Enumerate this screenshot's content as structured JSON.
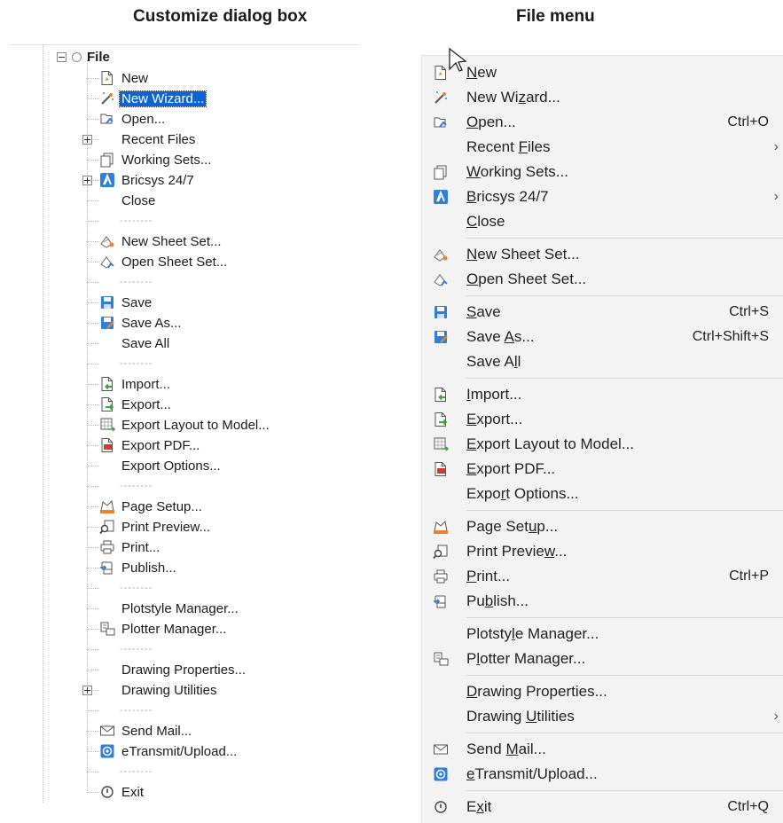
{
  "headings": {
    "left": "Customize dialog box",
    "right": "File menu"
  },
  "tree": {
    "root_label": "File",
    "nodes": [
      {
        "label": "New",
        "icon": "new-document-icon",
        "selected": false,
        "expandable": false
      },
      {
        "label": "New Wizard...",
        "icon": "magic-wand-icon",
        "selected": true,
        "expandable": false
      },
      {
        "label": "Open...",
        "icon": "open-file-icon",
        "selected": false,
        "expandable": false
      },
      {
        "label": "Recent Files",
        "icon": "",
        "selected": false,
        "expandable": true
      },
      {
        "label": "Working Sets...",
        "icon": "working-sets-icon",
        "selected": false,
        "expandable": false
      },
      {
        "label": "Bricsys 24/7",
        "icon": "bricsys-icon",
        "selected": false,
        "expandable": true
      },
      {
        "label": "Close",
        "icon": "",
        "selected": false,
        "expandable": false
      },
      {
        "separator": "--------"
      },
      {
        "label": "New Sheet Set...",
        "icon": "new-sheet-set-icon",
        "selected": false,
        "expandable": false
      },
      {
        "label": "Open Sheet Set...",
        "icon": "open-sheet-set-icon",
        "selected": false,
        "expandable": false
      },
      {
        "separator": "--------"
      },
      {
        "label": "Save",
        "icon": "save-icon",
        "selected": false,
        "expandable": false
      },
      {
        "label": "Save As...",
        "icon": "save-as-icon",
        "selected": false,
        "expandable": false
      },
      {
        "label": "Save All",
        "icon": "",
        "selected": false,
        "expandable": false
      },
      {
        "separator": "--------"
      },
      {
        "label": "Import...",
        "icon": "import-icon",
        "selected": false,
        "expandable": false
      },
      {
        "label": "Export...",
        "icon": "export-icon",
        "selected": false,
        "expandable": false
      },
      {
        "label": "Export Layout to Model...",
        "icon": "export-layout-icon",
        "selected": false,
        "expandable": false
      },
      {
        "label": "Export PDF...",
        "icon": "pdf-icon",
        "selected": false,
        "expandable": false
      },
      {
        "label": "Export Options...",
        "icon": "",
        "selected": false,
        "expandable": false
      },
      {
        "separator": "--------"
      },
      {
        "label": "Page Setup...",
        "icon": "page-setup-icon",
        "selected": false,
        "expandable": false
      },
      {
        "label": "Print Preview...",
        "icon": "print-preview-icon",
        "selected": false,
        "expandable": false
      },
      {
        "label": "Print...",
        "icon": "printer-icon",
        "selected": false,
        "expandable": false
      },
      {
        "label": "Publish...",
        "icon": "publish-icon",
        "selected": false,
        "expandable": false
      },
      {
        "separator": "--------"
      },
      {
        "label": "Plotstyle Manager...",
        "icon": "",
        "selected": false,
        "expandable": false
      },
      {
        "label": "Plotter Manager...",
        "icon": "plotter-manager-icon",
        "selected": false,
        "expandable": false
      },
      {
        "separator": "--------"
      },
      {
        "label": "Drawing Properties...",
        "icon": "",
        "selected": false,
        "expandable": false
      },
      {
        "label": "Drawing Utilities",
        "icon": "",
        "selected": false,
        "expandable": true
      },
      {
        "separator": "--------"
      },
      {
        "label": "Send Mail...",
        "icon": "mail-icon",
        "selected": false,
        "expandable": false
      },
      {
        "label": "eTransmit/Upload...",
        "icon": "etransmit-icon",
        "selected": false,
        "expandable": false
      },
      {
        "separator": "--------"
      },
      {
        "label": "Exit",
        "icon": "exit-icon",
        "selected": false,
        "expandable": false
      }
    ]
  },
  "menu": {
    "items": [
      {
        "label": "New",
        "mnemonic": 0,
        "icon": "new-document-icon",
        "shortcut": "",
        "submenu": false
      },
      {
        "label": "New Wizard...",
        "mnemonic": 6,
        "icon": "magic-wand-icon",
        "shortcut": "",
        "submenu": false
      },
      {
        "label": "Open...",
        "mnemonic": 0,
        "icon": "open-file-icon",
        "shortcut": "Ctrl+O",
        "submenu": false
      },
      {
        "label": "Recent Files",
        "mnemonic": 7,
        "icon": "",
        "shortcut": "",
        "submenu": true
      },
      {
        "label": "Working Sets...",
        "mnemonic": 0,
        "icon": "working-sets-icon",
        "shortcut": "",
        "submenu": false
      },
      {
        "label": "Bricsys 24/7",
        "mnemonic": 0,
        "icon": "bricsys-icon",
        "shortcut": "",
        "submenu": true
      },
      {
        "label": "Close",
        "mnemonic": 0,
        "icon": "",
        "shortcut": "",
        "submenu": false
      },
      {
        "separator": true
      },
      {
        "label": "New Sheet Set...",
        "mnemonic": 0,
        "icon": "new-sheet-set-icon",
        "shortcut": "",
        "submenu": false
      },
      {
        "label": "Open Sheet Set...",
        "mnemonic": 0,
        "icon": "open-sheet-set-icon",
        "shortcut": "",
        "submenu": false
      },
      {
        "separator": true
      },
      {
        "label": "Save",
        "mnemonic": 0,
        "icon": "save-icon",
        "shortcut": "Ctrl+S",
        "submenu": false
      },
      {
        "label": "Save As...",
        "mnemonic": 5,
        "icon": "save-as-icon",
        "shortcut": "Ctrl+Shift+S",
        "submenu": false
      },
      {
        "label": "Save All",
        "mnemonic": 6,
        "icon": "",
        "shortcut": "",
        "submenu": false
      },
      {
        "separator": true
      },
      {
        "label": "Import...",
        "mnemonic": 0,
        "icon": "import-icon",
        "shortcut": "",
        "submenu": false
      },
      {
        "label": "Export...",
        "mnemonic": 0,
        "icon": "export-icon",
        "shortcut": "",
        "submenu": false
      },
      {
        "label": "Export Layout to Model...",
        "mnemonic": 0,
        "icon": "export-layout-icon",
        "shortcut": "",
        "submenu": false
      },
      {
        "label": "Export PDF...",
        "mnemonic": 0,
        "icon": "pdf-icon",
        "shortcut": "",
        "submenu": false
      },
      {
        "label": "Export Options...",
        "mnemonic": 4,
        "icon": "",
        "shortcut": "",
        "submenu": false
      },
      {
        "separator": true
      },
      {
        "label": "Page Setup...",
        "mnemonic": 8,
        "icon": "page-setup-icon",
        "shortcut": "",
        "submenu": false
      },
      {
        "label": "Print Preview...",
        "mnemonic": 12,
        "icon": "print-preview-icon",
        "shortcut": "",
        "submenu": false
      },
      {
        "label": "Print...",
        "mnemonic": 0,
        "icon": "printer-icon",
        "shortcut": "Ctrl+P",
        "submenu": false
      },
      {
        "label": "Publish...",
        "mnemonic": 2,
        "icon": "publish-icon",
        "shortcut": "",
        "submenu": false
      },
      {
        "separator": true
      },
      {
        "label": "Plotstyle Manager...",
        "mnemonic": 7,
        "icon": "",
        "shortcut": "",
        "submenu": false
      },
      {
        "label": "Plotter Manager...",
        "mnemonic": 1,
        "icon": "plotter-manager-icon",
        "shortcut": "",
        "submenu": false
      },
      {
        "separator": true
      },
      {
        "label": "Drawing Properties...",
        "mnemonic": 0,
        "icon": "",
        "shortcut": "",
        "submenu": false
      },
      {
        "label": "Drawing Utilities",
        "mnemonic": 8,
        "icon": "",
        "shortcut": "",
        "submenu": true
      },
      {
        "separator": true
      },
      {
        "label": "Send Mail...",
        "mnemonic": 5,
        "icon": "mail-icon",
        "shortcut": "",
        "submenu": false
      },
      {
        "label": "eTransmit/Upload...",
        "mnemonic": 0,
        "icon": "etransmit-icon",
        "shortcut": "",
        "submenu": false
      },
      {
        "separator": true
      },
      {
        "label": "Exit",
        "mnemonic": 1,
        "icon": "exit-icon",
        "shortcut": "Ctrl+Q",
        "submenu": false
      }
    ],
    "submenu_arrow": "›"
  },
  "colors": {
    "selection": "#0a64d6",
    "menu_bg": "#f3f3f3",
    "icon_blue": "#2f7fd8",
    "icon_orange": "#e8832a",
    "icon_red": "#d23a2a",
    "icon_green": "#3aa83a"
  }
}
